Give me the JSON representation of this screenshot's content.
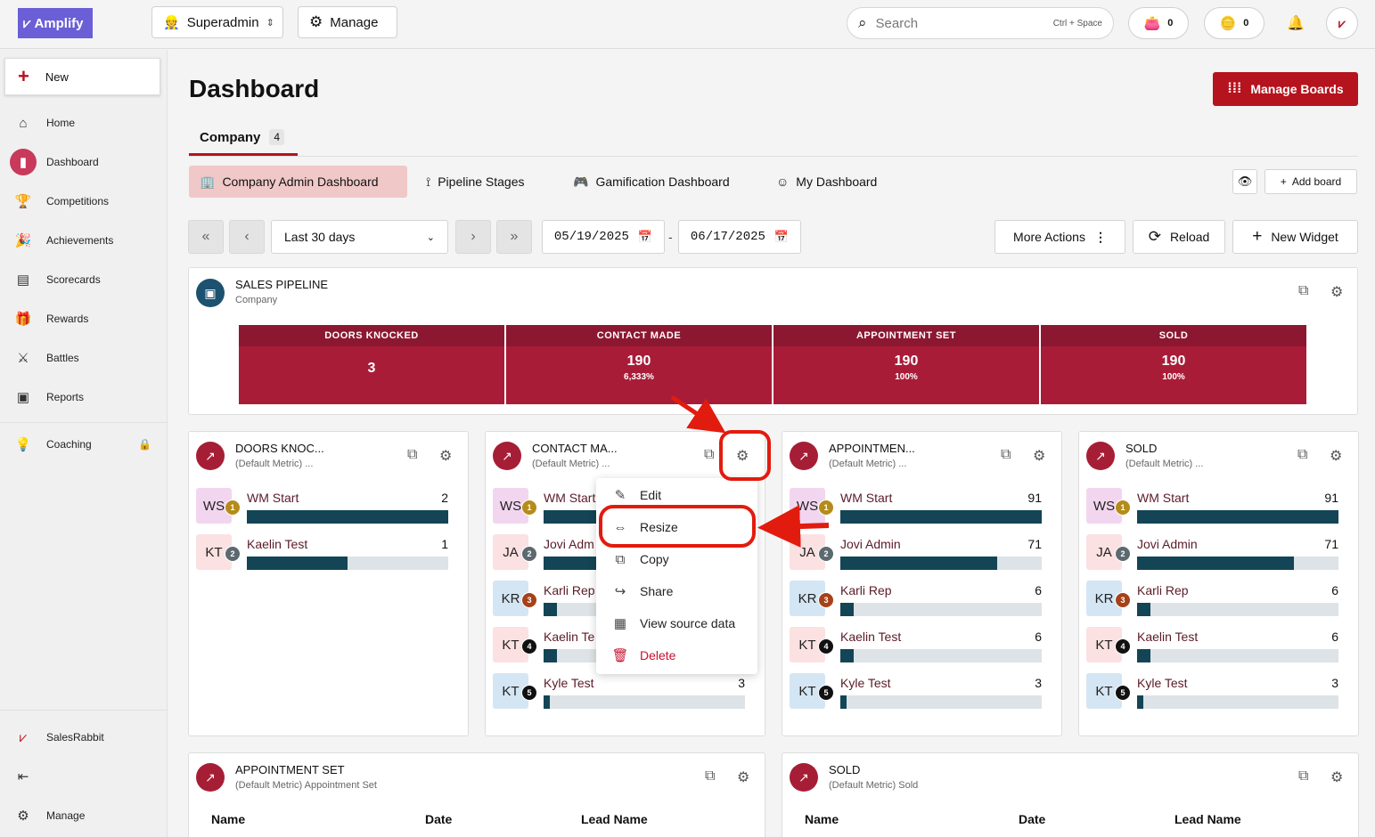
{
  "topbar": {
    "logo_text": "Amplify",
    "role_label": "Superadmin",
    "manage_label": "Manage",
    "search_placeholder": "Search",
    "search_shortcut": "Ctrl + Space",
    "wallet_count": "0",
    "coins_count": "0"
  },
  "sidebar": {
    "new_label": "New",
    "items": [
      {
        "label": "Home",
        "icon": "home-icon"
      },
      {
        "label": "Dashboard",
        "icon": "chart-icon"
      },
      {
        "label": "Competitions",
        "icon": "trophy-icon"
      },
      {
        "label": "Achievements",
        "icon": "confetti-icon"
      },
      {
        "label": "Scorecards",
        "icon": "scorecard-icon"
      },
      {
        "label": "Rewards",
        "icon": "gift-icon"
      },
      {
        "label": "Battles",
        "icon": "swords-icon"
      },
      {
        "label": "Reports",
        "icon": "report-icon"
      },
      {
        "label": "Coaching",
        "icon": "lightbulb-icon"
      }
    ],
    "footer_brand": "SalesRabbit",
    "footer_manage": "Manage"
  },
  "page": {
    "title": "Dashboard",
    "manage_boards": "Manage Boards",
    "tab_label": "Company",
    "tab_count": "4",
    "subtabs": [
      "Company Admin Dashboard",
      "Pipeline Stages",
      "Gamification Dashboard",
      "My Dashboard"
    ],
    "add_board": "Add board"
  },
  "filters": {
    "range_label": "Last 30 days",
    "start_date": "05/19/2025",
    "end_date": "06/17/2025",
    "more_actions": "More Actions",
    "reload": "Reload",
    "new_widget": "New Widget"
  },
  "pipeline": {
    "title": "SALES PIPELINE",
    "subtitle": "Company",
    "stages": [
      {
        "name": "DOORS KNOCKED",
        "value": "3",
        "pct": ""
      },
      {
        "name": "CONTACT MADE",
        "value": "190",
        "pct": "6,333%"
      },
      {
        "name": "APPOINTMENT SET",
        "value": "190",
        "pct": "100%"
      },
      {
        "name": "SOLD",
        "value": "190",
        "pct": "100%"
      }
    ]
  },
  "leaderboards": [
    {
      "title": "DOORS KNOC...",
      "subtitle": "(Default Metric) ...",
      "rows": [
        {
          "initials": "WS",
          "rank": "1",
          "name": "WM Start",
          "value": "2",
          "fraction": 1.0
        },
        {
          "initials": "KT",
          "rank": "2",
          "name": "Kaelin Test",
          "value": "1",
          "fraction": 0.5
        }
      ]
    },
    {
      "title": "CONTACT MA...",
      "subtitle": "(Default Metric) ...",
      "rows": [
        {
          "initials": "WS",
          "rank": "1",
          "name": "WM Start",
          "value": "",
          "fraction": 1.0
        },
        {
          "initials": "JA",
          "rank": "2",
          "name": "Jovi Adm",
          "value": "",
          "fraction": 0.78
        },
        {
          "initials": "KR",
          "rank": "3",
          "name": "Karli Rep",
          "value": "",
          "fraction": 0.066
        },
        {
          "initials": "KT",
          "rank": "4",
          "name": "Kaelin Te",
          "value": "",
          "fraction": 0.066
        },
        {
          "initials": "KT",
          "rank": "5",
          "name": "Kyle Test",
          "value": "3",
          "fraction": 0.033
        }
      ]
    },
    {
      "title": "APPOINTMEN...",
      "subtitle": "(Default Metric) ...",
      "rows": [
        {
          "initials": "WS",
          "rank": "1",
          "name": "WM Start",
          "value": "91",
          "fraction": 1.0
        },
        {
          "initials": "JA",
          "rank": "2",
          "name": "Jovi Admin",
          "value": "71",
          "fraction": 0.78
        },
        {
          "initials": "KR",
          "rank": "3",
          "name": "Karli Rep",
          "value": "6",
          "fraction": 0.066
        },
        {
          "initials": "KT",
          "rank": "4",
          "name": "Kaelin Test",
          "value": "6",
          "fraction": 0.066
        },
        {
          "initials": "KT",
          "rank": "5",
          "name": "Kyle Test",
          "value": "3",
          "fraction": 0.033
        }
      ]
    },
    {
      "title": "SOLD",
      "subtitle": "(Default Metric) ...",
      "rows": [
        {
          "initials": "WS",
          "rank": "1",
          "name": "WM Start",
          "value": "91",
          "fraction": 1.0
        },
        {
          "initials": "JA",
          "rank": "2",
          "name": "Jovi Admin",
          "value": "71",
          "fraction": 0.78
        },
        {
          "initials": "KR",
          "rank": "3",
          "name": "Karli Rep",
          "value": "6",
          "fraction": 0.066
        },
        {
          "initials": "KT",
          "rank": "4",
          "name": "Kaelin Test",
          "value": "6",
          "fraction": 0.066
        },
        {
          "initials": "KT",
          "rank": "5",
          "name": "Kyle Test",
          "value": "3",
          "fraction": 0.033
        }
      ]
    }
  ],
  "context_menu": {
    "items": [
      {
        "label": "Edit",
        "icon": "pencil-icon"
      },
      {
        "label": "Resize",
        "icon": "resize-icon"
      },
      {
        "label": "Copy",
        "icon": "copy-icon"
      },
      {
        "label": "Share",
        "icon": "share-icon"
      },
      {
        "label": "View source data",
        "icon": "table-icon"
      },
      {
        "label": "Delete",
        "icon": "trash-icon"
      }
    ]
  },
  "tables": [
    {
      "title": "APPOINTMENT SET",
      "subtitle": "(Default Metric) Appointment Set",
      "columns": [
        "Name",
        "Date",
        "Lead Name"
      ]
    },
    {
      "title": "SOLD",
      "subtitle": "(Default Metric) Sold",
      "columns": [
        "Name",
        "Date",
        "Lead Name"
      ]
    }
  ],
  "colors": {
    "brand_red": "#b5131d",
    "pipeline_red": "#a91c38",
    "bar_fill": "#134556",
    "annotation_red": "#e21b0f",
    "avatar_colors": [
      "#f2d6ef",
      "#fbe1e1",
      "#d4e6f4",
      "#fbe1e1",
      "#d4e6f4"
    ],
    "rank_colors": [
      "#b58b1b",
      "#5c6a70",
      "#a5421a",
      "#111111",
      "#111111"
    ]
  }
}
